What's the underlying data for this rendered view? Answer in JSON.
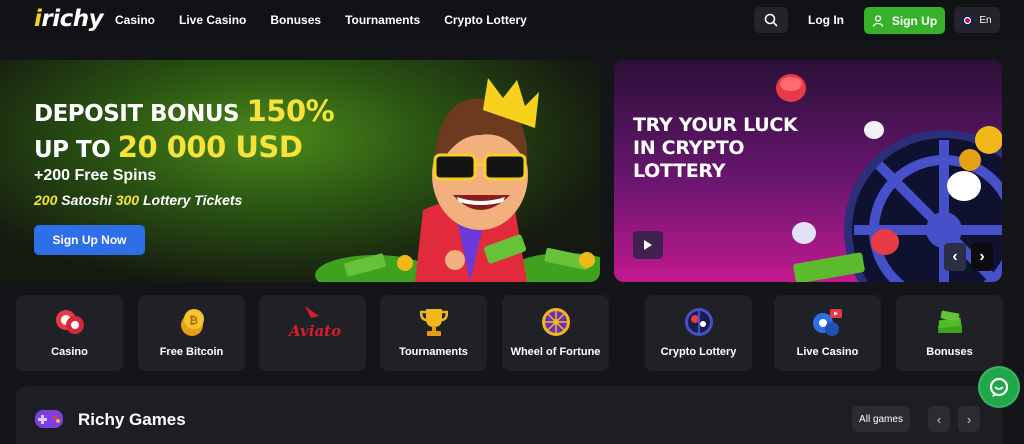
{
  "brand": {
    "logo_text": "richy",
    "accent": "#f7e23a",
    "signup_color": "#36b22a",
    "cta_color": "#2e6fe8"
  },
  "header": {
    "nav": [
      "Casino",
      "Live Casino",
      "Bonuses",
      "Tournaments",
      "Crypto Lottery"
    ],
    "search_icon": "search-icon",
    "login_label": "Log In",
    "signup_label": "Sign Up",
    "language": "En"
  },
  "hero_left": {
    "line1_text": "DEPOSIT BONUS ",
    "line1_highlight": "150%",
    "line2_text": "UP TO ",
    "line2_highlight": "20 000 USD",
    "spins": "+200 Free Spins",
    "extra1_num": "200",
    "extra1_text": " Satoshi ",
    "extra2_num": "300",
    "extra2_text": " Lottery Tickets",
    "cta_label": "Sign Up Now"
  },
  "hero_right": {
    "title_line1": "TRY YOUR LUCK",
    "title_line2": "IN CRYPTO",
    "title_line3": "LOTTERY",
    "prev_icon": "‹",
    "next_icon": "›"
  },
  "categories": [
    {
      "label": "Casino",
      "icon": "casino-chips-icon"
    },
    {
      "label": "Free Bitcoin",
      "icon": "bitcoin-coins-icon"
    },
    {
      "label": "",
      "icon": "aviator-logo-icon"
    },
    {
      "label": "Tournaments",
      "icon": "trophy-icon"
    },
    {
      "label": "Wheel of Fortune",
      "icon": "wheel-icon"
    },
    {
      "label": "Crypto Lottery",
      "icon": "lottery-icon"
    },
    {
      "label": "Live Casino",
      "icon": "live-casino-icon"
    },
    {
      "label": "Bonuses",
      "icon": "money-stack-icon"
    }
  ],
  "games": {
    "title": "Richy Games",
    "all_label": "All games",
    "prev": "‹",
    "next": "›"
  }
}
